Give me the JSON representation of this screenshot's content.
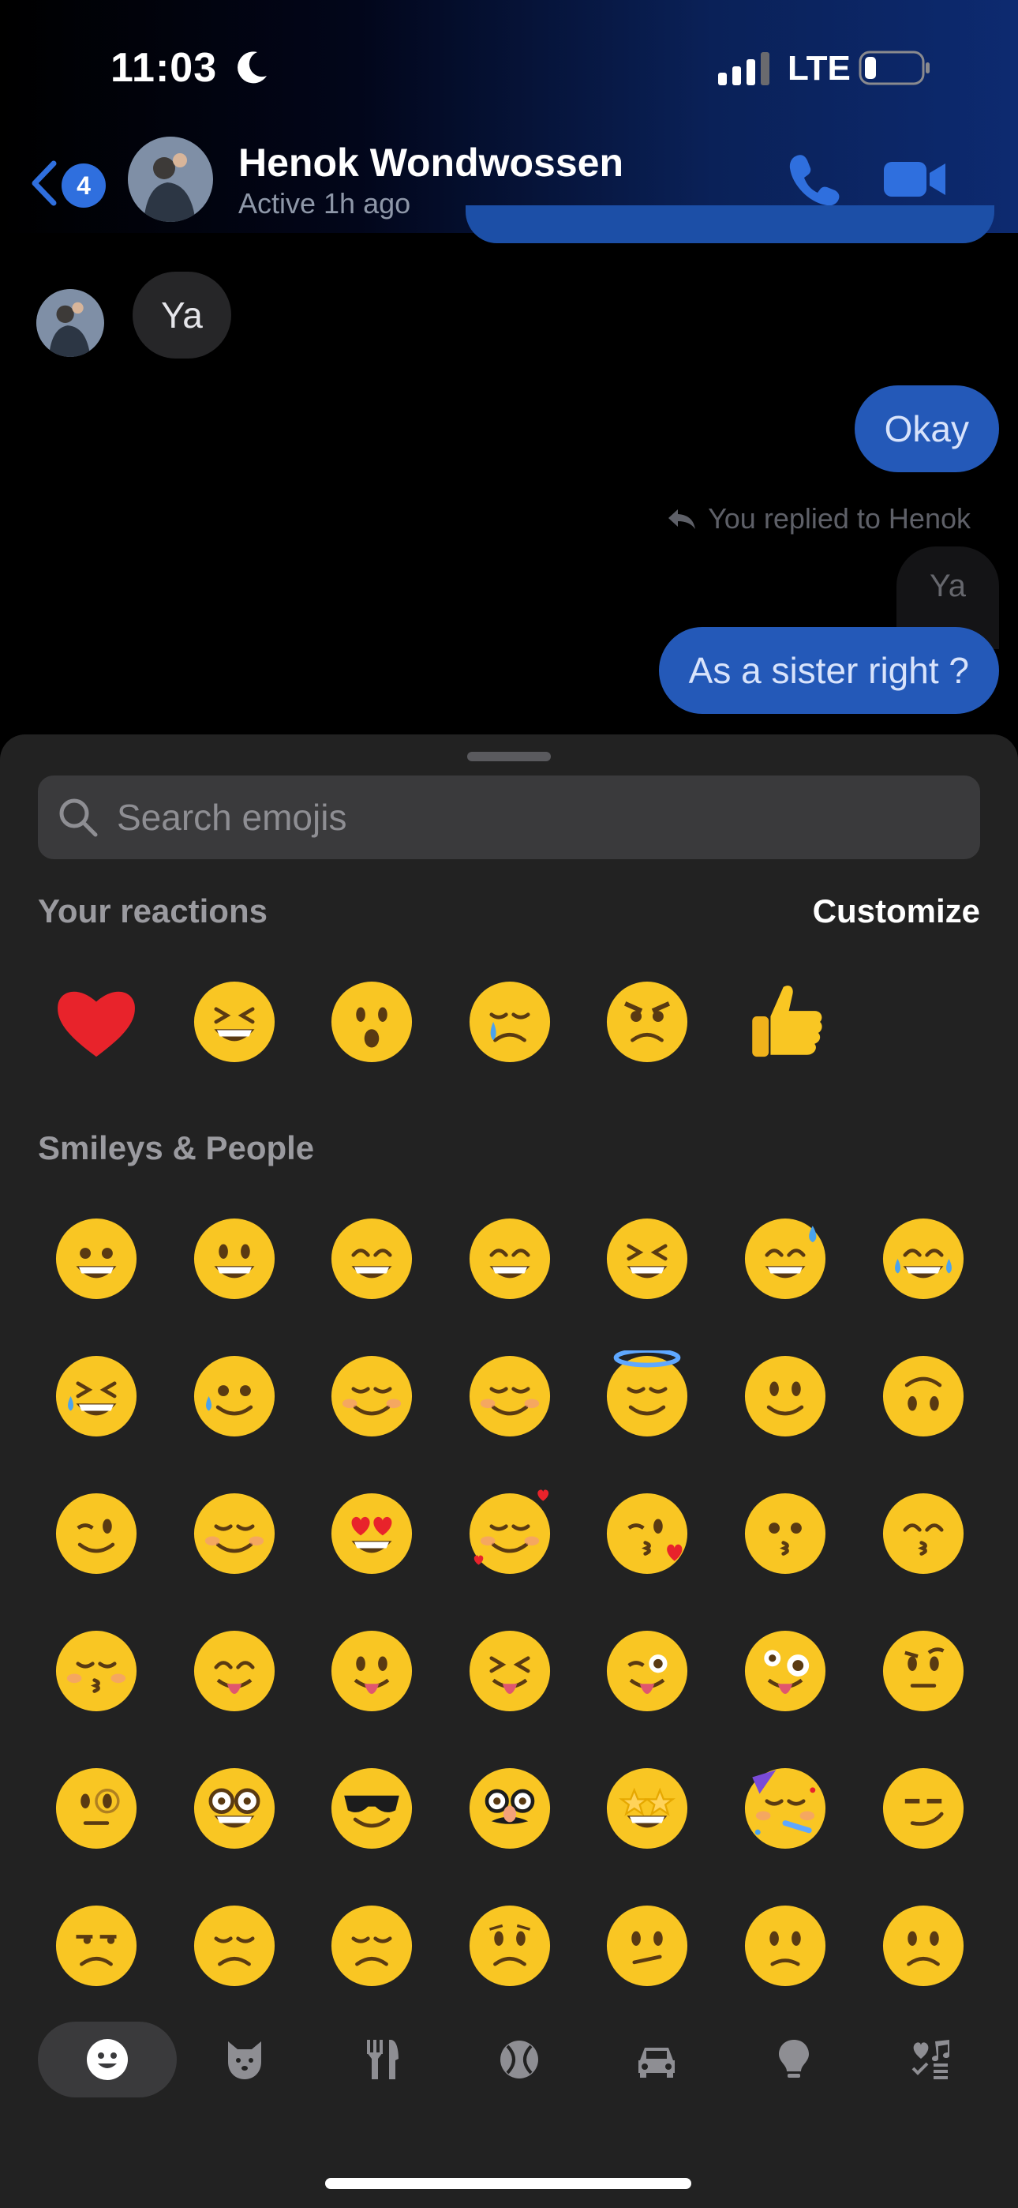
{
  "status_bar": {
    "time": "11:03",
    "network": "LTE"
  },
  "header": {
    "unread_count": "4",
    "contact_name": "Henok Wondwossen",
    "contact_status": "Active 1h ago"
  },
  "messages": {
    "incoming_text": "Ya",
    "outgoing_okay": "Okay",
    "reply_label": "You replied to Henok",
    "quoted_text": "Ya",
    "outgoing_question": "As a sister right ?"
  },
  "emoji_picker": {
    "search_placeholder": "Search emojis",
    "reactions_label": "Your reactions",
    "customize_label": "Customize",
    "reactions": [
      "heart",
      "laughing",
      "surprised",
      "crying",
      "angry",
      "thumbs-up"
    ],
    "smileys_label": "Smileys & People",
    "smileys_rows": [
      [
        "grinning",
        "smiley",
        "smile",
        "grin",
        "laughing",
        "sweat-smile",
        "joy"
      ],
      [
        "rofl",
        "holding-back-tears",
        "relaxed",
        "blush",
        "innocent",
        "slightly-smiling",
        "upside-down"
      ],
      [
        "wink",
        "relieved",
        "heart-eyes",
        "smiling-hearts",
        "kissing-heart",
        "kissing",
        "kissing-smiling-eyes"
      ],
      [
        "kissing-closed-eyes",
        "yum",
        "stuck-out-tongue",
        "squinting-tongue",
        "winking-tongue",
        "zany",
        "raised-eyebrow"
      ],
      [
        "monocle",
        "nerd",
        "sunglasses",
        "disguised",
        "star-struck",
        "partying",
        "smirk"
      ],
      [
        "unamused",
        "disappointed",
        "pensive",
        "worried",
        "confused",
        "slightly-frowning",
        "frowning"
      ]
    ],
    "category_tabs": [
      "smileys-tab",
      "animals-tab",
      "food-tab",
      "activity-tab",
      "travel-tab",
      "objects-tab",
      "symbols-tab"
    ],
    "active_tab": "smileys-tab"
  },
  "colors": {
    "accent_blue": "#2459b8",
    "sheet_bg": "#222222",
    "emoji_yellow": "#f9c623"
  }
}
